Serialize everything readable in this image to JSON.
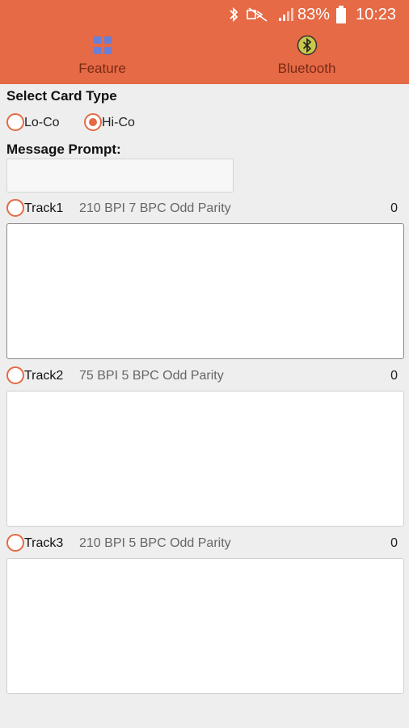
{
  "status_bar": {
    "battery_percent": "83%",
    "time": "10:23",
    "icons": [
      "bluetooth-icon",
      "mute-icon",
      "signal-icon",
      "battery-icon"
    ]
  },
  "tabs": [
    {
      "label": "Feature",
      "icon": "grid-icon"
    },
    {
      "label": "Bluetooth",
      "icon": "bluetooth-icon"
    }
  ],
  "card_type": {
    "title": "Select Card Type",
    "options": [
      {
        "label": "Lo-Co",
        "selected": false
      },
      {
        "label": "Hi-Co",
        "selected": true
      }
    ]
  },
  "message_prompt": {
    "label": "Message Prompt:",
    "value": ""
  },
  "tracks": [
    {
      "label": "Track1",
      "description": "210 BPI 7 BPC Odd Parity",
      "count": "0",
      "selected": false,
      "value": ""
    },
    {
      "label": "Track2",
      "description": "75 BPI 5 BPC Odd Parity",
      "count": "0",
      "selected": false,
      "value": ""
    },
    {
      "label": "Track3",
      "description": "210 BPI 5 BPC Odd Parity",
      "count": "0",
      "selected": false,
      "value": ""
    }
  ],
  "colors": {
    "accent": "#e56a45",
    "background": "#eeeeee",
    "tab_text": "#7a2a14"
  }
}
